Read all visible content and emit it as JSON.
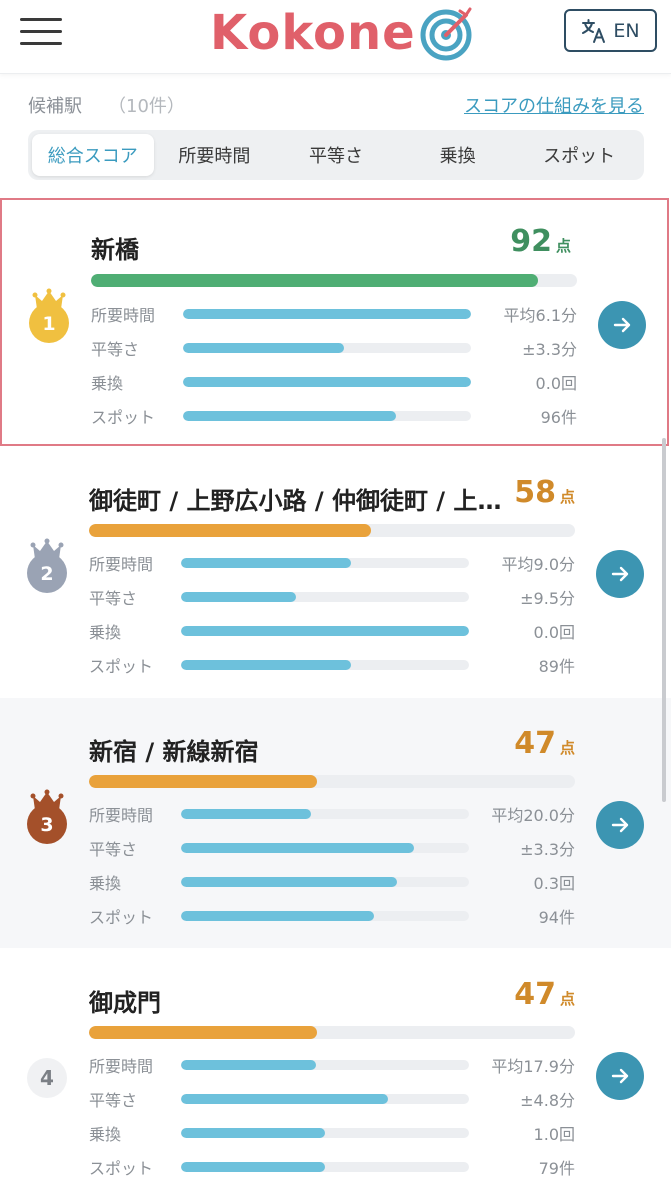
{
  "header": {
    "logo_text": "Kokone",
    "lang_label": "EN",
    "menu_icon": "hamburger-menu-icon",
    "lang_icon": "translate-icon",
    "brand_color": "#e0606a"
  },
  "candidates": {
    "title": "候補駅",
    "count": "（10件）",
    "score_link": "スコアの仕組みを見る"
  },
  "tabs": [
    {
      "label": "総合スコア",
      "active": true
    },
    {
      "label": "所要時間",
      "active": false
    },
    {
      "label": "平等さ",
      "active": false
    },
    {
      "label": "乗換",
      "active": false
    },
    {
      "label": "スポット",
      "active": false
    }
  ],
  "metric_labels": [
    "所要時間",
    "平等さ",
    "乗換",
    "スポット"
  ],
  "stations": [
    {
      "rank": "1",
      "name": "新橋",
      "score": "92",
      "unit": "点",
      "score_color": "#3f8f5f",
      "total_bar_color": "#4fae74",
      "total_fraction": 0.92,
      "medal": "gold",
      "metrics": [
        {
          "value": "平均6.1分",
          "fraction": 1.0
        },
        {
          "value": "±3.3分",
          "fraction": 0.56
        },
        {
          "value": "0.0回",
          "fraction": 1.0
        },
        {
          "value": "96件",
          "fraction": 0.74
        }
      ]
    },
    {
      "rank": "2",
      "name": "御徒町 / 上野広小路 / 仲御徒町 / 上野御徒町",
      "score": "58",
      "unit": "点",
      "score_color": "#d08a2a",
      "total_bar_color": "#e9a23b",
      "total_fraction": 0.58,
      "medal": "silver",
      "metrics": [
        {
          "value": "平均9.0分",
          "fraction": 0.59
        },
        {
          "value": "±9.5分",
          "fraction": 0.4
        },
        {
          "value": "0.0回",
          "fraction": 1.0
        },
        {
          "value": "89件",
          "fraction": 0.59
        }
      ]
    },
    {
      "rank": "3",
      "name": "新宿 / 新線新宿",
      "score": "47",
      "unit": "点",
      "score_color": "#d08a2a",
      "total_bar_color": "#e9a23b",
      "total_fraction": 0.47,
      "medal": "bronze",
      "metrics": [
        {
          "value": "平均20.0分",
          "fraction": 0.45
        },
        {
          "value": "±3.3分",
          "fraction": 0.81
        },
        {
          "value": "0.3回",
          "fraction": 0.75
        },
        {
          "value": "94件",
          "fraction": 0.67
        }
      ]
    },
    {
      "rank": "4",
      "name": "御成門",
      "score": "47",
      "unit": "点",
      "score_color": "#d08a2a",
      "total_bar_color": "#e9a23b",
      "total_fraction": 0.47,
      "medal": "none",
      "metrics": [
        {
          "value": "平均17.9分",
          "fraction": 0.47
        },
        {
          "value": "±4.8分",
          "fraction": 0.72
        },
        {
          "value": "1.0回",
          "fraction": 0.5
        },
        {
          "value": "79件",
          "fraction": 0.5
        }
      ]
    }
  ]
}
